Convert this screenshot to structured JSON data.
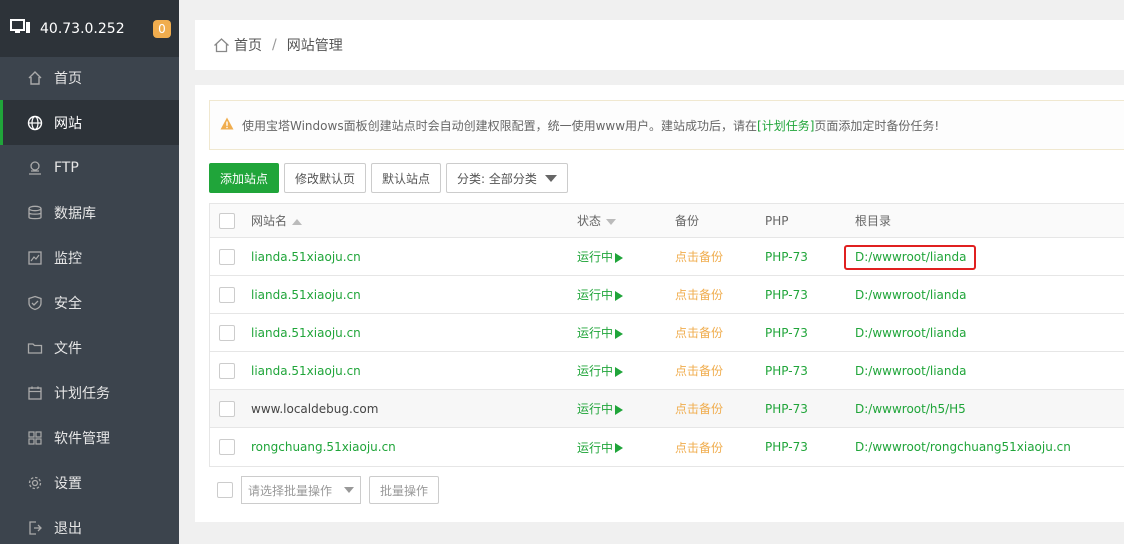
{
  "sidebar": {
    "ip": "40.73.0.252",
    "badge": "0",
    "items": [
      {
        "label": "首页",
        "icon": "home-icon"
      },
      {
        "label": "网站",
        "icon": "globe-icon"
      },
      {
        "label": "FTP",
        "icon": "ftp-icon"
      },
      {
        "label": "数据库",
        "icon": "database-icon"
      },
      {
        "label": "监控",
        "icon": "monitor-icon"
      },
      {
        "label": "安全",
        "icon": "shield-icon"
      },
      {
        "label": "文件",
        "icon": "folder-icon"
      },
      {
        "label": "计划任务",
        "icon": "calendar-icon"
      },
      {
        "label": "软件管理",
        "icon": "grid-icon"
      },
      {
        "label": "设置",
        "icon": "gear-icon"
      },
      {
        "label": "退出",
        "icon": "logout-icon"
      }
    ]
  },
  "breadcrumb": {
    "home": "首页",
    "separator": "/",
    "current": "网站管理"
  },
  "notice": {
    "text_before": "使用宝塔Windows面板创建站点时会自动创建权限配置，统一使用www用户。建站成功后，请在",
    "link": "[计划任务]",
    "text_after": "页面添加定时备份任务!"
  },
  "toolbar": {
    "add_site": "添加站点",
    "edit_default_page": "修改默认页",
    "default_site": "默认站点",
    "category": "分类: 全部分类"
  },
  "table": {
    "headers": {
      "name": "网站名",
      "status": "状态",
      "backup": "备份",
      "php": "PHP",
      "root": "根目录"
    },
    "rows": [
      {
        "name": "lianda.51xiaoju.cn",
        "status": "运行中",
        "backup": "点击备份",
        "php": "PHP-73",
        "root": "D:/wwwroot/lianda"
      },
      {
        "name": "lianda.51xiaoju.cn",
        "status": "运行中",
        "backup": "点击备份",
        "php": "PHP-73",
        "root": "D:/wwwroot/lianda"
      },
      {
        "name": "lianda.51xiaoju.cn",
        "status": "运行中",
        "backup": "点击备份",
        "php": "PHP-73",
        "root": "D:/wwwroot/lianda"
      },
      {
        "name": "lianda.51xiaoju.cn",
        "status": "运行中",
        "backup": "点击备份",
        "php": "PHP-73",
        "root": "D:/wwwroot/lianda"
      },
      {
        "name": "www.localdebug.com",
        "status": "运行中",
        "backup": "点击备份",
        "php": "PHP-73",
        "root": "D:/wwwroot/h5/H5"
      },
      {
        "name": "rongchuang.51xiaoju.cn",
        "status": "运行中",
        "backup": "点击备份",
        "php": "PHP-73",
        "root": "D:/wwwroot/rongchuang51xiaoju.cn"
      }
    ]
  },
  "batch": {
    "placeholder": "请选择批量操作",
    "button": "批量操作"
  },
  "colors": {
    "accent": "#20a53a",
    "warning": "#f0ad4e",
    "sidebar_bg": "#3c444d",
    "highlight": "#e02020"
  }
}
